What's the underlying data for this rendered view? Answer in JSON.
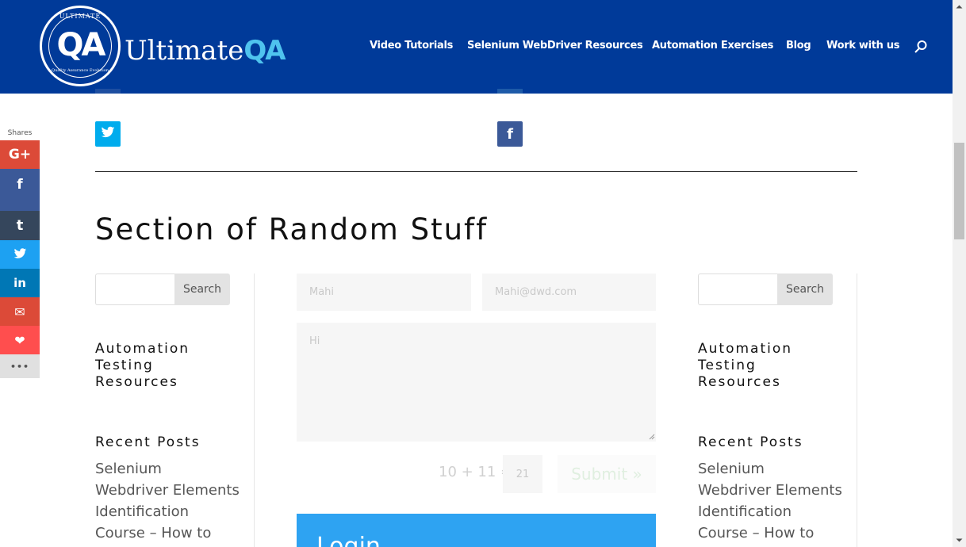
{
  "header": {
    "logo_ring_top": "ULTIMATE",
    "logo_mark": "QA",
    "logo_ring_bottom": "Quality Assurance Evolution",
    "brand_name": "Ultimate",
    "brand_qa": "QA",
    "nav": [
      "Video Tutorials",
      "Selenium WebDriver Resources",
      "Automation Exercises",
      "Blog",
      "Work with us"
    ],
    "search_icon": "search-icon",
    "bg_color": "#003a99"
  },
  "share_bar": {
    "label": "Shares",
    "buttons": [
      {
        "icon": "google-plus-icon",
        "glyph": "G+",
        "color": "#dc4a38"
      },
      {
        "icon": "facebook-icon",
        "glyph": "f",
        "color": "#3b5998"
      },
      {
        "icon": "tumblr-icon",
        "glyph": "t",
        "color": "#35465c"
      },
      {
        "icon": "twitter-icon",
        "glyph": "🐦",
        "color": "#1da1f2"
      },
      {
        "icon": "linkedin-icon",
        "glyph": "in",
        "color": "#0077b5"
      },
      {
        "icon": "email-icon",
        "glyph": "✉",
        "color": "#dc4a38"
      },
      {
        "icon": "heart-icon",
        "glyph": "❤",
        "color": "#ff4e4e"
      },
      {
        "icon": "more-icon",
        "glyph": "•••",
        "color": "#e0e0e0"
      }
    ]
  },
  "social_row": {
    "twitter_glyph": "🐦",
    "twitter_color": "#00aced",
    "facebook_glyph": "f",
    "facebook_color": "#3b5998"
  },
  "section": {
    "title": "Section of Random Stuff"
  },
  "sidebar_left": {
    "search_button": "Search",
    "widget_title": "Automation Testing Resources",
    "widget_title_lines": [
      "Automation",
      "Testing",
      "Resources"
    ],
    "recent_title": "Recent Posts",
    "recent_lines": [
      "Selenium",
      "Webdriver Elements",
      "Identification",
      "Course – How to"
    ]
  },
  "sidebar_right": {
    "search_button": "Search",
    "widget_title_lines": [
      "Automation",
      "Testing",
      "Resources"
    ],
    "recent_title": "Recent Posts",
    "recent_lines": [
      "Selenium",
      "Webdriver Elements",
      "Identification",
      "Course – How to"
    ]
  },
  "contact_form": {
    "name_value": "Mahi",
    "email_value": "Mahi@dwd.com",
    "message_value": "Hi",
    "captcha_question": "10 + 11 =",
    "captcha_answer": "21",
    "submit_label": "Submit",
    "submit_arrow": "»"
  },
  "login": {
    "title": "Login",
    "bg_color": "#2ea3f2"
  }
}
